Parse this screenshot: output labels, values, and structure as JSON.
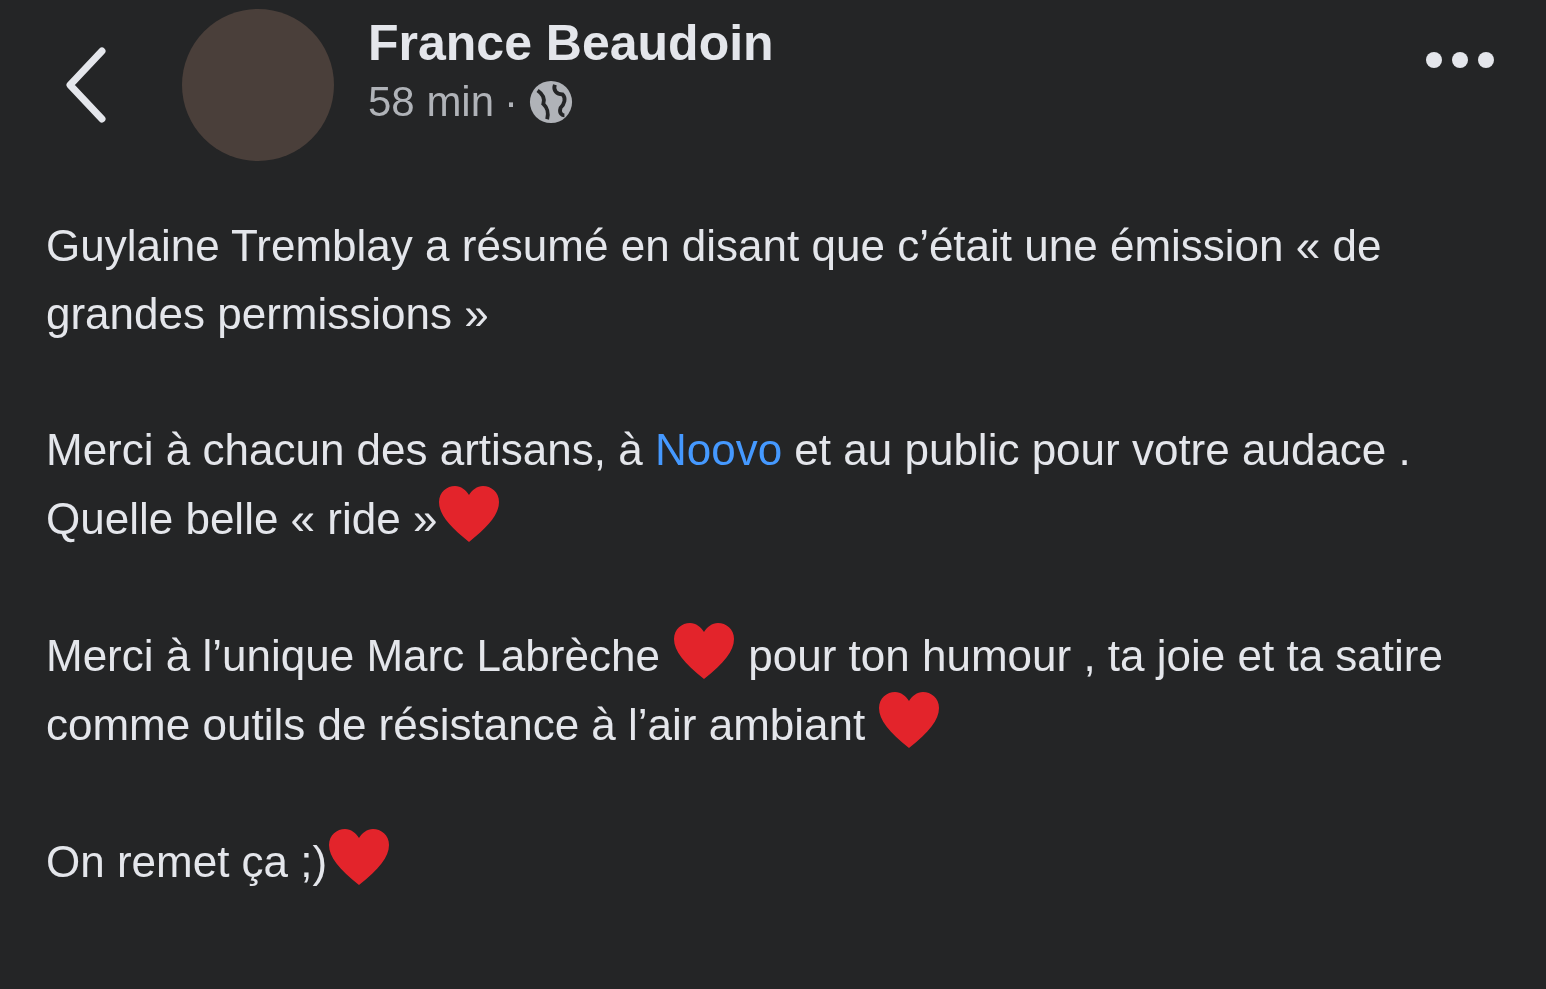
{
  "header": {
    "author": "France Beaudoin",
    "time": "58 min",
    "separator": "·"
  },
  "paragraphs": [
    [
      {
        "kind": "text",
        "text": "Guylaine Tremblay a résumé en disant que c’était une émission  « de grandes permissions »"
      }
    ],
    [
      {
        "kind": "text",
        "text": "Merci à chacun des artisans, à "
      },
      {
        "kind": "link",
        "text": "Noovo"
      },
      {
        "kind": "text",
        "text": " et au public pour votre audace . Quelle belle « ride »"
      },
      {
        "kind": "heart"
      }
    ],
    [
      {
        "kind": "text",
        "text": "Merci à l’unique Marc Labrèche "
      },
      {
        "kind": "heart"
      },
      {
        "kind": "text",
        "text": "  pour ton humour , ta joie et ta satire comme outils de résistance à l’air ambiant "
      },
      {
        "kind": "heart"
      }
    ],
    [
      {
        "kind": "text",
        "text": "On remet ça ;)"
      },
      {
        "kind": "heart"
      }
    ]
  ]
}
